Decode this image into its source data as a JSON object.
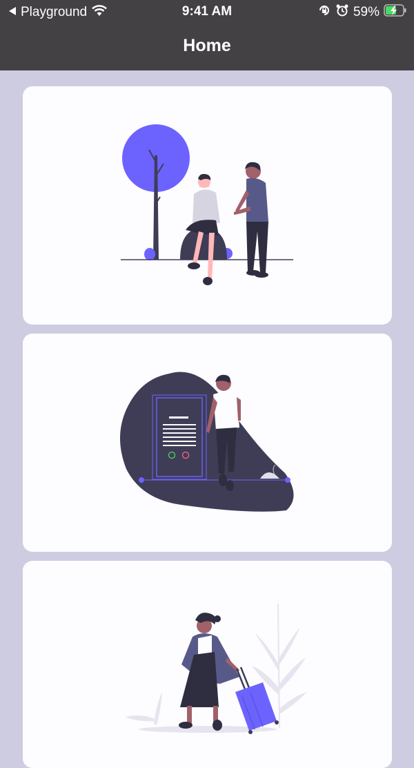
{
  "status_bar": {
    "back_app": "Playground",
    "time": "9:41 AM",
    "battery": "59%",
    "icons": [
      "back-arrow-icon",
      "wifi-icon",
      "rotation-lock-icon",
      "alarm-icon",
      "battery-icon"
    ]
  },
  "nav": {
    "title": "Home"
  },
  "cards": [
    {
      "illustration": "two-people-talking-near-tree"
    },
    {
      "illustration": "person-leaning-on-document-blob"
    },
    {
      "illustration": "traveler-with-suitcase"
    }
  ],
  "colors": {
    "bar": "#434144",
    "background": "#cecce0",
    "card": "#fdfcff",
    "accent": "#6c63ff",
    "dark": "#3f3d56"
  }
}
